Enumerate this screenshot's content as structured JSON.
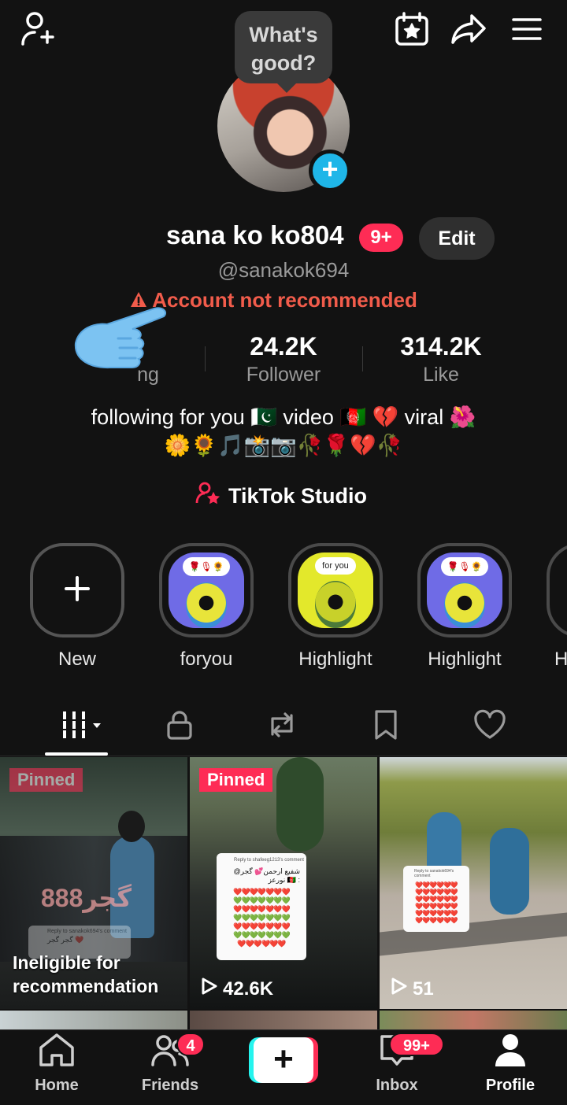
{
  "tooltip": "What's good?",
  "profile": {
    "name": "sana ko ko804",
    "notif_badge": "9+",
    "edit_label": "Edit",
    "handle": "@sanakok694",
    "warning": "Account not recommended"
  },
  "stats": [
    {
      "value": "",
      "label": "ng"
    },
    {
      "value": "24.2K",
      "label": "Follower"
    },
    {
      "value": "314.2K",
      "label": "Like"
    }
  ],
  "bio": {
    "line1": "following for you 🇵🇰 video 🇦🇫 💔 viral 🌺",
    "line2": "🌼🌻🎵📸📷🥀🌹💔🥀"
  },
  "studio_label": "TikTok Studio",
  "highlights": [
    {
      "label": "New",
      "icon": "plus-icon"
    },
    {
      "label": "foryou",
      "sticker": "🌹🎙🌻"
    },
    {
      "label": "Highlight",
      "sticker": "for you"
    },
    {
      "label": "Highlight",
      "sticker": "🌹🎙🌻"
    },
    {
      "label": "H"
    }
  ],
  "tabs": [
    "grid-icon",
    "lock-icon",
    "repost-icon",
    "bookmark-icon",
    "heart-icon"
  ],
  "videos": [
    {
      "pinned": "Pinned",
      "overlay": "گجر888",
      "status_line1": "Ineligible for",
      "status_line2": "recommendation",
      "card_title": "Reply to sanakok694's comment",
      "card_text": "گجر گجر ❤️"
    },
    {
      "pinned": "Pinned",
      "views": "42.6K",
      "card_title": "Reply to shafeeg1213's comment",
      "card_text1": "@شفیع ارحمن💕 گجر",
      "card_text2": "نورعز 🇦🇫 :"
    },
    {
      "views": "51",
      "card_title": "Reply to sanakok694's comment"
    }
  ],
  "nav": {
    "home": "Home",
    "friends": "Friends",
    "friends_badge": "4",
    "inbox": "Inbox",
    "inbox_badge": "99+",
    "profile": "Profile"
  },
  "colors": {
    "accent": "#fe2c55",
    "cyan": "#25f4ee",
    "warning": "#f15c4b",
    "background": "#121212"
  }
}
